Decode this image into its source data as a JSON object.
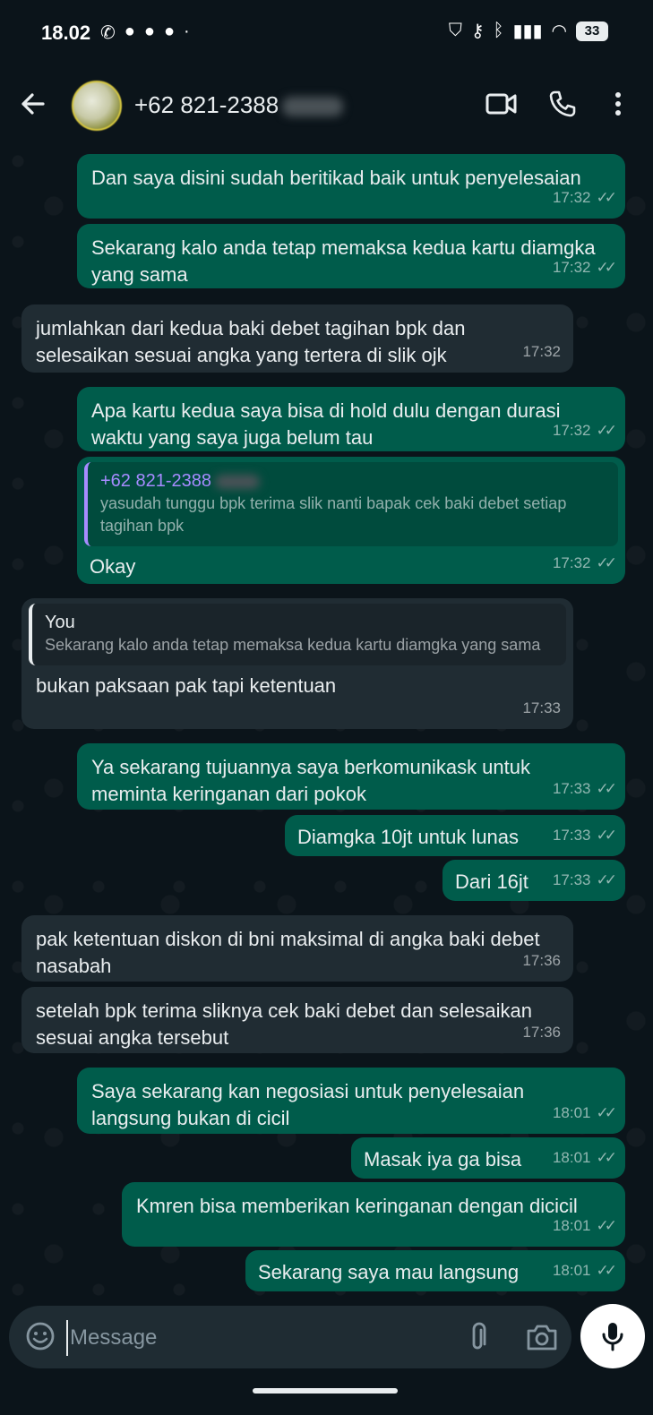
{
  "status_bar": {
    "time": "18.02",
    "battery": "33"
  },
  "header": {
    "contact_name": "+62 821-2388"
  },
  "messages": [
    {
      "dir": "out",
      "text": "Dan saya disini sudah beritikad baik untuk penyelesaian",
      "time": "17:32"
    },
    {
      "dir": "out",
      "text": "Sekarang kalo anda tetap memaksa kedua kartu diamgka yang sama",
      "time": "17:32"
    },
    {
      "dir": "in",
      "text": "jumlahkan dari kedua baki debet tagihan bpk dan selesaikan sesuai angka yang tertera di slik ojk",
      "time": "17:32"
    },
    {
      "dir": "out",
      "text": "Apa kartu kedua saya bisa di hold dulu dengan durasi waktu yang saya juga belum tau",
      "time": "17:32"
    },
    {
      "dir": "out",
      "quote_author": "+62 821-2388",
      "quote_text": "yasudah tunggu bpk terima slik nanti bapak cek baki debet setiap tagihan bpk",
      "text": "Okay",
      "time": "17:32"
    },
    {
      "dir": "in",
      "quote_author": "You",
      "quote_text": "Sekarang kalo anda tetap memaksa kedua kartu diamgka yang sama",
      "text": "bukan paksaan pak tapi ketentuan",
      "time": "17:33"
    },
    {
      "dir": "out",
      "text": "Ya sekarang tujuannya saya berkomunikask untuk meminta keringanan dari pokok",
      "time": "17:33"
    },
    {
      "dir": "out",
      "text": "Diamgka 10jt untuk lunas",
      "time": "17:33"
    },
    {
      "dir": "out",
      "text": "Dari 16jt",
      "time": "17:33"
    },
    {
      "dir": "in",
      "text": "pak ketentuan diskon di bni maksimal di angka baki debet nasabah",
      "time": "17:36"
    },
    {
      "dir": "in",
      "text": "setelah bpk terima sliknya cek baki debet dan selesaikan sesuai angka tersebut",
      "time": "17:36"
    },
    {
      "dir": "out",
      "text": "Saya sekarang kan negosiasi untuk penyelesaian langsung bukan di cicil",
      "time": "18:01"
    },
    {
      "dir": "out",
      "text": "Masak iya ga bisa",
      "time": "18:01"
    },
    {
      "dir": "out",
      "text": "Kmren bisa memberikan keringanan dengan dicicil",
      "time": "18:01"
    },
    {
      "dir": "out",
      "text": "Sekarang saya mau langsung",
      "time": "18:01"
    }
  ],
  "composer": {
    "placeholder": "Message"
  },
  "icons": {
    "back": "arrow-left-icon",
    "video": "video-call-icon",
    "call": "phone-icon",
    "menu": "more-vert-icon",
    "emoji": "emoji-icon",
    "attach": "paperclip-icon",
    "camera": "camera-icon",
    "mic": "mic-icon"
  }
}
